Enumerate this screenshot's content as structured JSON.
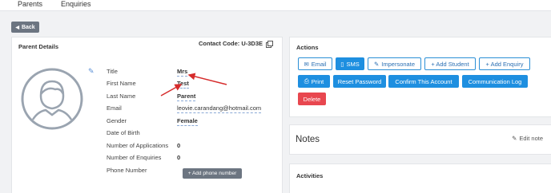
{
  "topnav": {
    "tabs": [
      "Parents",
      "Enquiries"
    ]
  },
  "back_label": "Back",
  "parent_details": {
    "title": "Parent Details",
    "contact_code": "Contact Code: U-3D3E",
    "fields": [
      {
        "label": "Title",
        "value": "Mrs"
      },
      {
        "label": "First Name",
        "value": "Test"
      },
      {
        "label": "Last Name",
        "value": "Parent"
      },
      {
        "label": "Email",
        "value": "leovie.carandang@hotmail.com"
      },
      {
        "label": "Gender",
        "value": "Female"
      },
      {
        "label": "Date of Birth",
        "value": ""
      },
      {
        "label": "Number of Applications",
        "value": "0"
      },
      {
        "label": "Number of Enquiries",
        "value": "0"
      },
      {
        "label": "Phone Number",
        "value": ""
      }
    ],
    "add_phone_label": "+ Add phone number"
  },
  "actions": {
    "title": "Actions",
    "buttons": [
      "Email",
      "SMS",
      "Impersonate",
      "+ Add Student",
      "+ Add Enquiry",
      "Print",
      "Reset Password",
      "Confirm This Account",
      "Communication Log",
      "Delete"
    ]
  },
  "notes": {
    "title": "Notes",
    "edit_label": "Edit note"
  },
  "activities": {
    "title": "Activities"
  },
  "colors": {
    "primary": "#1e8fe0",
    "danger": "#e8474f",
    "annotation": "#d62b2b",
    "muted_button": "#6c7581"
  }
}
